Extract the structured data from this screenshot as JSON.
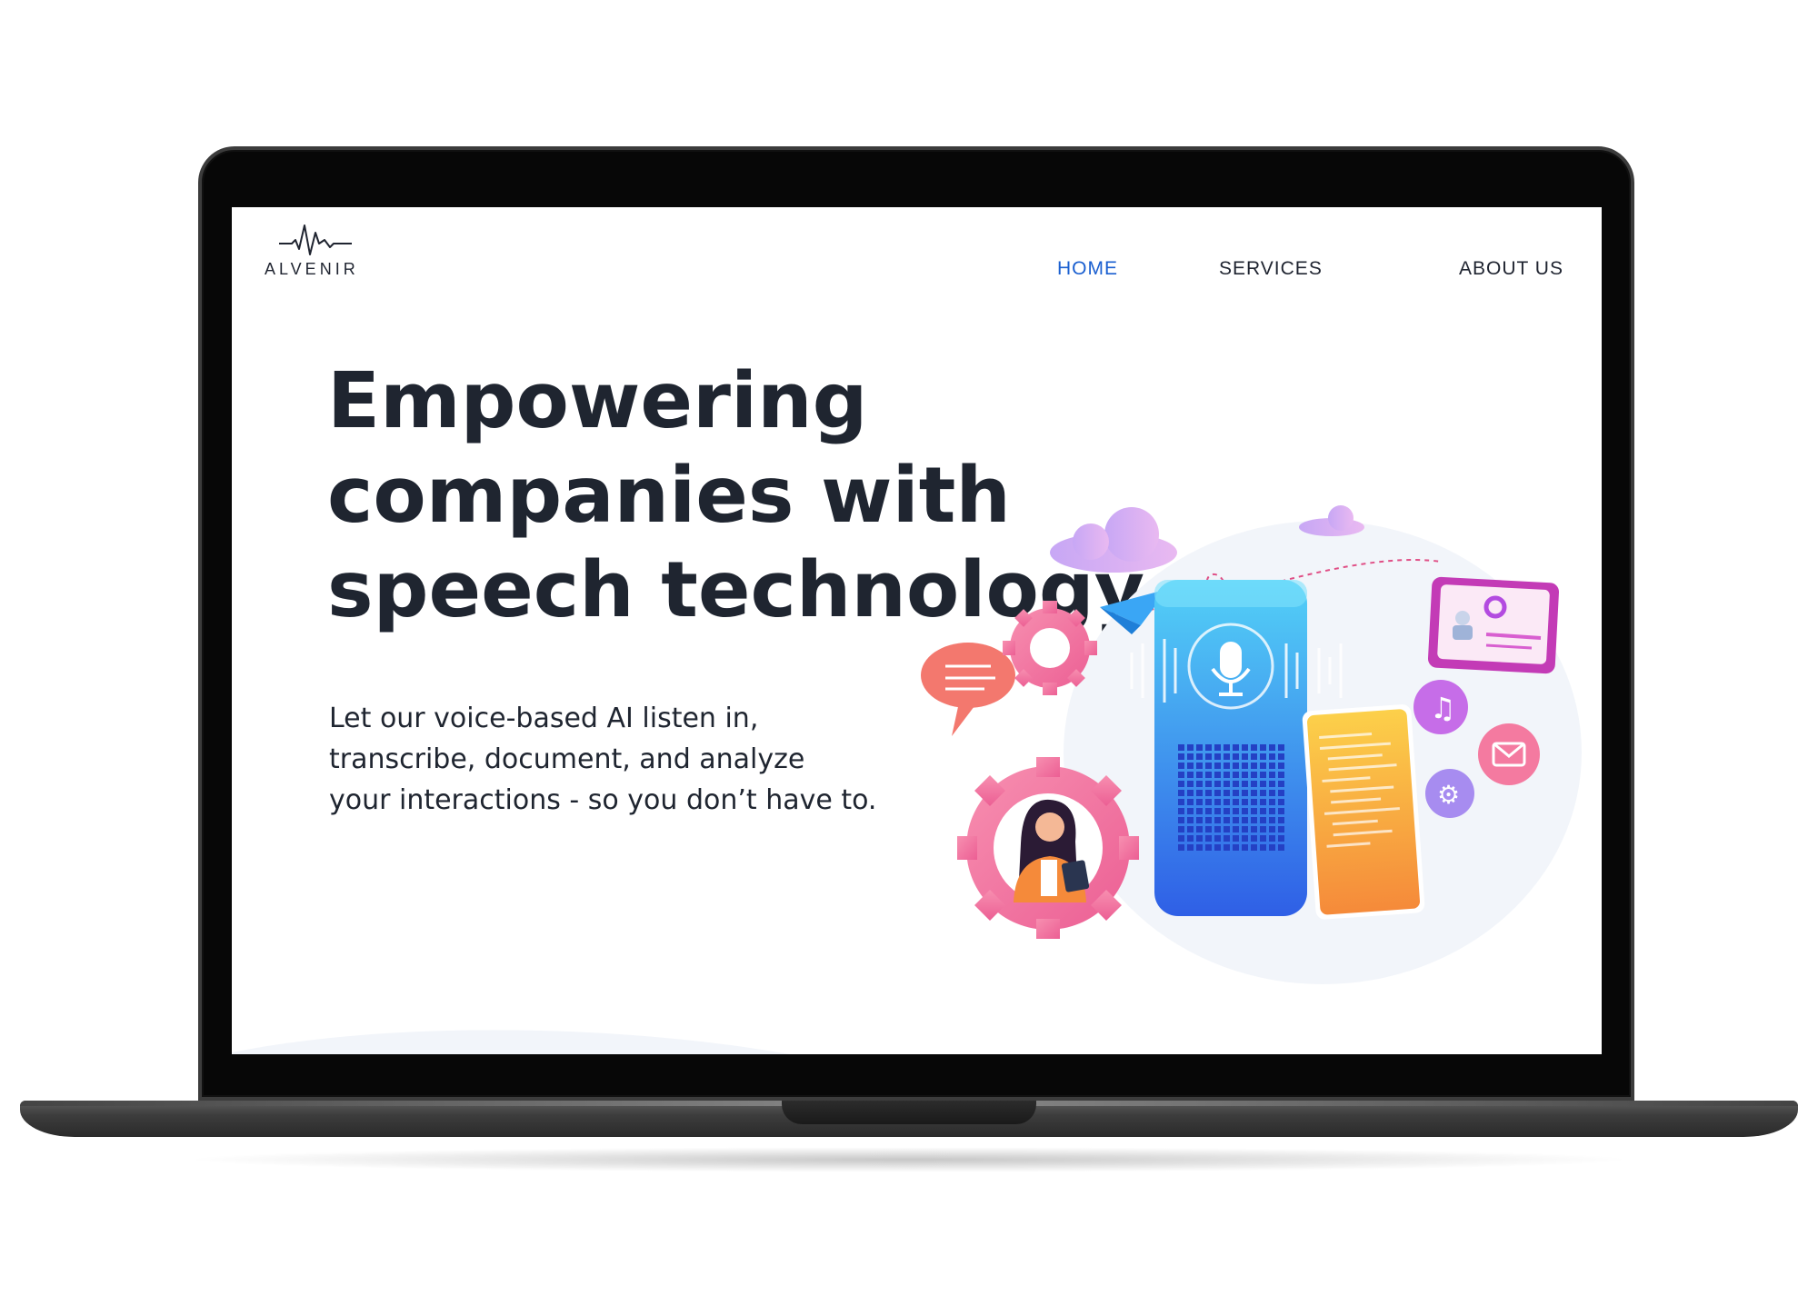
{
  "site": {
    "logo_text": "ALVENIR",
    "nav": [
      "HOME",
      "SERVICES",
      "ABOUT US"
    ],
    "active_nav": "HOME",
    "hero_title_lines": [
      "Empowering",
      "companies with",
      "speech technology"
    ],
    "hero_sub_lines": [
      "Let our voice-based AI listen in,",
      "transcribe, document, and analyze",
      "your interactions - so you don’t have to."
    ]
  },
  "colors": {
    "nav_active": "#1a5fd0",
    "text_dark": "#1f2530",
    "accent_pink": "#f06a9a",
    "accent_blue": "#3aa0f0",
    "accent_orange": "#f7a23b"
  },
  "icons": [
    "waveform-logo-icon",
    "microphone-icon",
    "gear-icon",
    "chat-bubble-icon",
    "music-note-icon",
    "mail-icon",
    "settings-icon",
    "robot-icon",
    "paper-plane-icon",
    "cloud-icon"
  ]
}
